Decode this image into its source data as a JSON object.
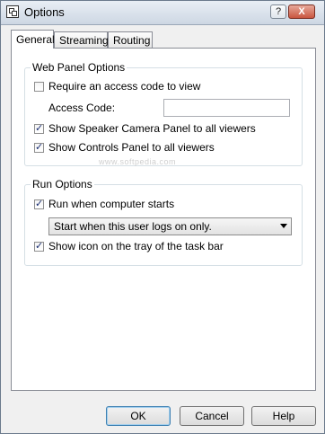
{
  "window": {
    "title": "Options",
    "help_button": "?",
    "close_button": "X"
  },
  "tabs": [
    {
      "label": "General",
      "active": true
    },
    {
      "label": "Streaming",
      "active": false
    },
    {
      "label": "Routing",
      "active": false
    }
  ],
  "web_panel": {
    "title": "Web Panel Options",
    "require_access_code": {
      "label": "Require an access code to view",
      "checked": false
    },
    "access_code": {
      "label": "Access Code:",
      "value": ""
    },
    "show_camera_panel": {
      "label": "Show Speaker Camera Panel to all viewers",
      "checked": true
    },
    "show_controls_panel": {
      "label": "Show Controls Panel to all viewers",
      "checked": true
    }
  },
  "watermark": "www.softpedia.com",
  "run_options": {
    "title": "Run Options",
    "run_when_starts": {
      "label": "Run when computer starts",
      "checked": true
    },
    "start_mode": {
      "selected": "Start when this user logs on only."
    },
    "show_tray_icon": {
      "label": "Show icon on the tray of the task bar",
      "checked": true
    }
  },
  "buttons": {
    "ok": "OK",
    "cancel": "Cancel",
    "help": "Help"
  }
}
